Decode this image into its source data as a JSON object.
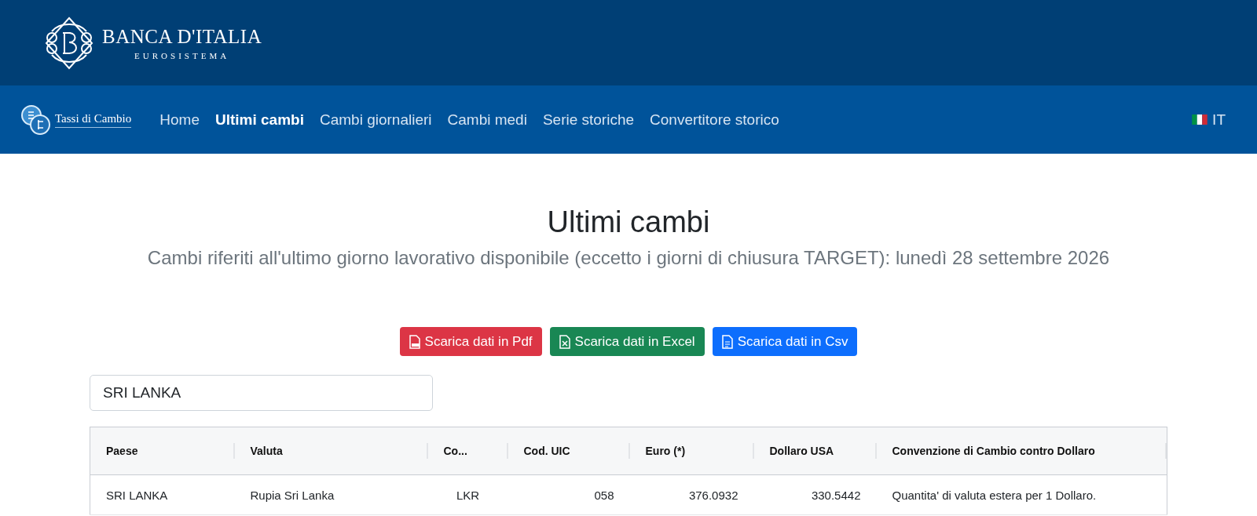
{
  "brand": {
    "name": "BANCA D'ITALIA",
    "tagline": "EUROSISTEMA"
  },
  "nav": {
    "logo_text": "Tassi di Cambio",
    "items": [
      {
        "label": "Home",
        "selected": false
      },
      {
        "label": "Ultimi cambi",
        "selected": true
      },
      {
        "label": "Cambi giornalieri",
        "selected": false
      },
      {
        "label": "Cambi medi",
        "selected": false
      },
      {
        "label": "Serie storiche",
        "selected": false
      },
      {
        "label": "Convertitore storico",
        "selected": false
      }
    ],
    "language": "IT"
  },
  "title": "Ultimi cambi",
  "subtitle": "Cambi riferiti all'ultimo giorno lavorativo disponibile (eccetto i giorni di chiusura TARGET): lunedì 28 settembre 2026",
  "downloads": [
    {
      "kind": "pdf",
      "label": "Scarica dati in Pdf",
      "color": "#dc3545"
    },
    {
      "kind": "excel",
      "label": "Scarica dati in Excel",
      "color": "#198754"
    },
    {
      "kind": "csv",
      "label": "Scarica dati in Csv",
      "color": "#0d6efd"
    }
  ],
  "search": {
    "value": "SRI LANKA"
  },
  "table": {
    "columns": [
      "Paese",
      "Valuta",
      "Co...",
      "Cod. UIC",
      "Euro (*)",
      "Dollaro USA",
      "Convenzione di Cambio contro Dollaro"
    ],
    "rows": [
      [
        "SRI LANKA",
        "Rupia Sri Lanka",
        "LKR",
        "058",
        "376.0932",
        "330.5442",
        "Quantita' di valuta estera per 1 Dollaro."
      ]
    ]
  }
}
